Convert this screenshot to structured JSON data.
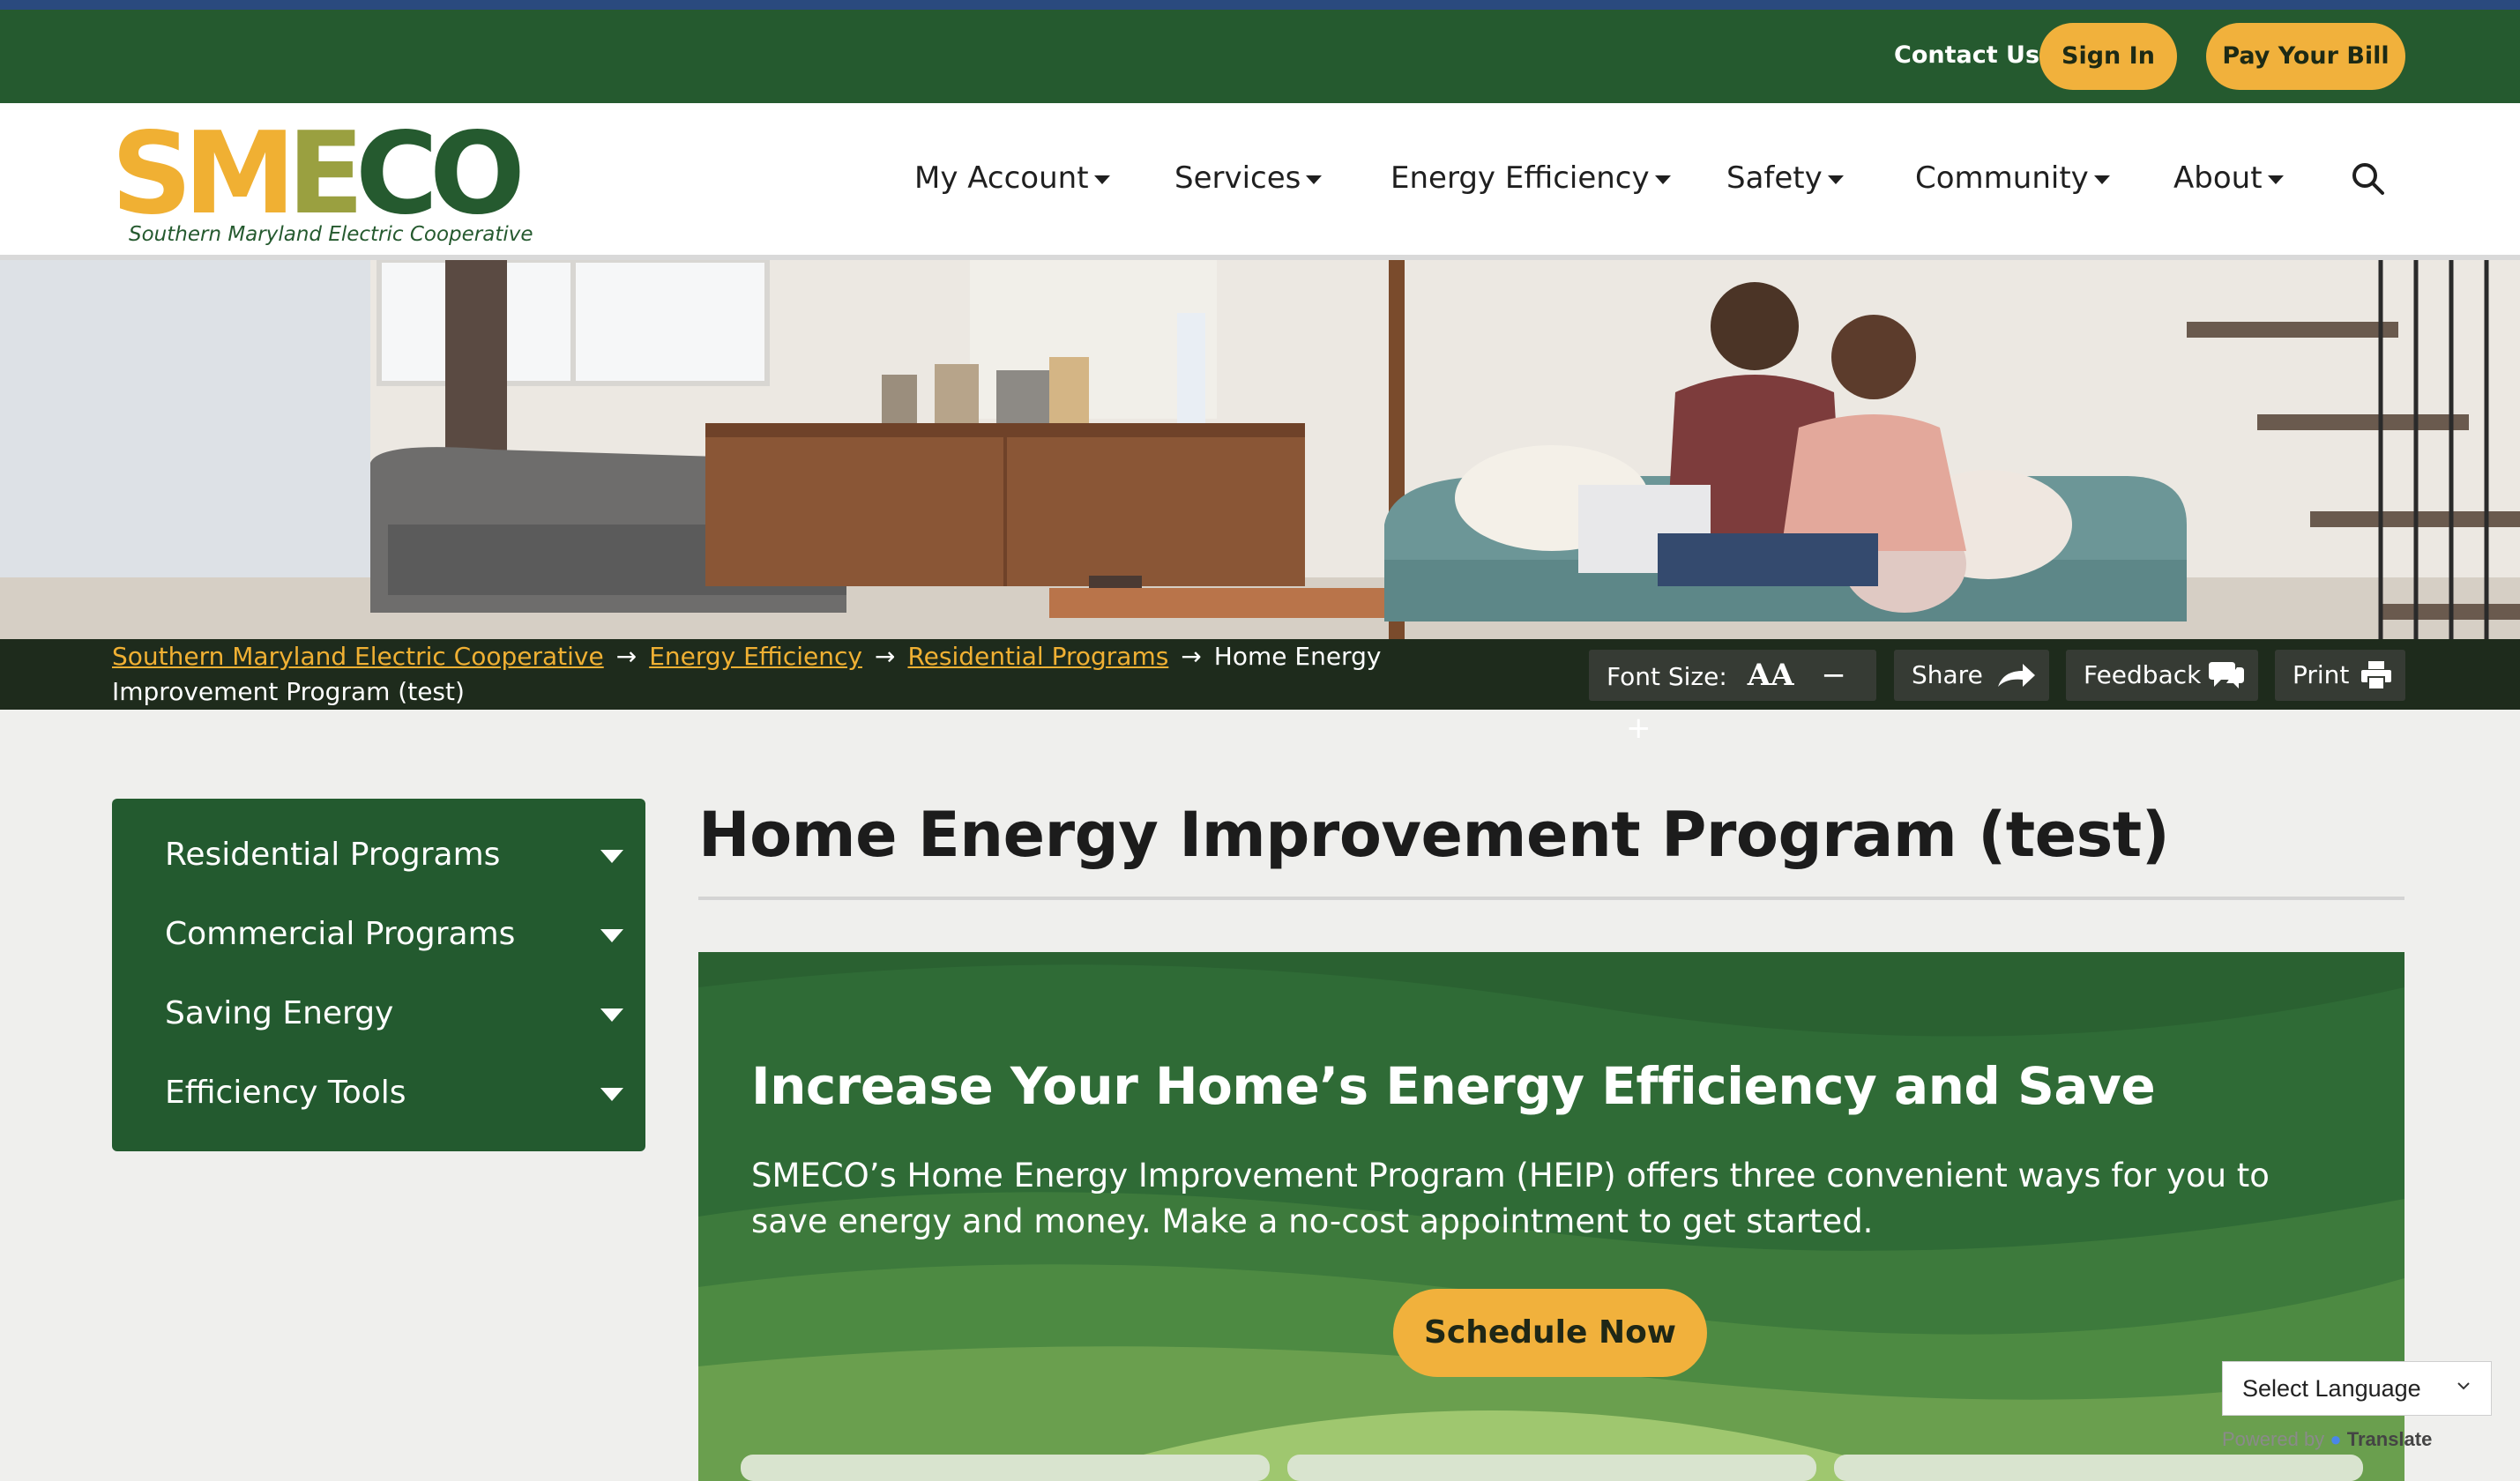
{
  "utility": {
    "contact": "Contact Us",
    "sign_in": "Sign In",
    "pay_bill": "Pay Your Bill"
  },
  "logo": {
    "letters_sm": "SM",
    "letters_e": "E",
    "letters_co": "CO",
    "tagline": "Southern Maryland Electric Cooperative"
  },
  "nav": {
    "items": [
      "My Account",
      "Services",
      "Energy Efficiency",
      "Safety",
      "Community",
      "About"
    ],
    "search_icon": "search-icon"
  },
  "breadcrumb": {
    "items": [
      "Southern Maryland Electric Cooperative",
      "Energy Efficiency",
      "Residential Programs"
    ],
    "current": "Home Energy Improvement Program (test)",
    "separator": "→"
  },
  "tools": {
    "font_size": "Font Size:",
    "font_icon": "AA",
    "minus": "−",
    "plus": "+",
    "share": "Share",
    "feedback": "Feedback",
    "print": "Print"
  },
  "sidebar": {
    "items": [
      "Residential Programs",
      "Commercial Programs",
      "Saving Energy",
      "Efficiency Tools"
    ]
  },
  "page": {
    "title": "Home Energy Improvement Program (test)"
  },
  "promo": {
    "heading": "Increase Your Home’s Energy Efficiency and Save",
    "body": "SMECO’s Home Energy Improvement Program (HEIP) offers three convenient ways for you to save energy and money. Make a no-cost appointment to get started.",
    "cta": "Schedule Now"
  },
  "translate": {
    "select": "Select Language",
    "powered": "Powered by",
    "brand": "Translate"
  },
  "colors": {
    "brand_green": "#255a2f",
    "accent_gold": "#f1b13c",
    "crumb_bar": "#1e2b1c"
  }
}
